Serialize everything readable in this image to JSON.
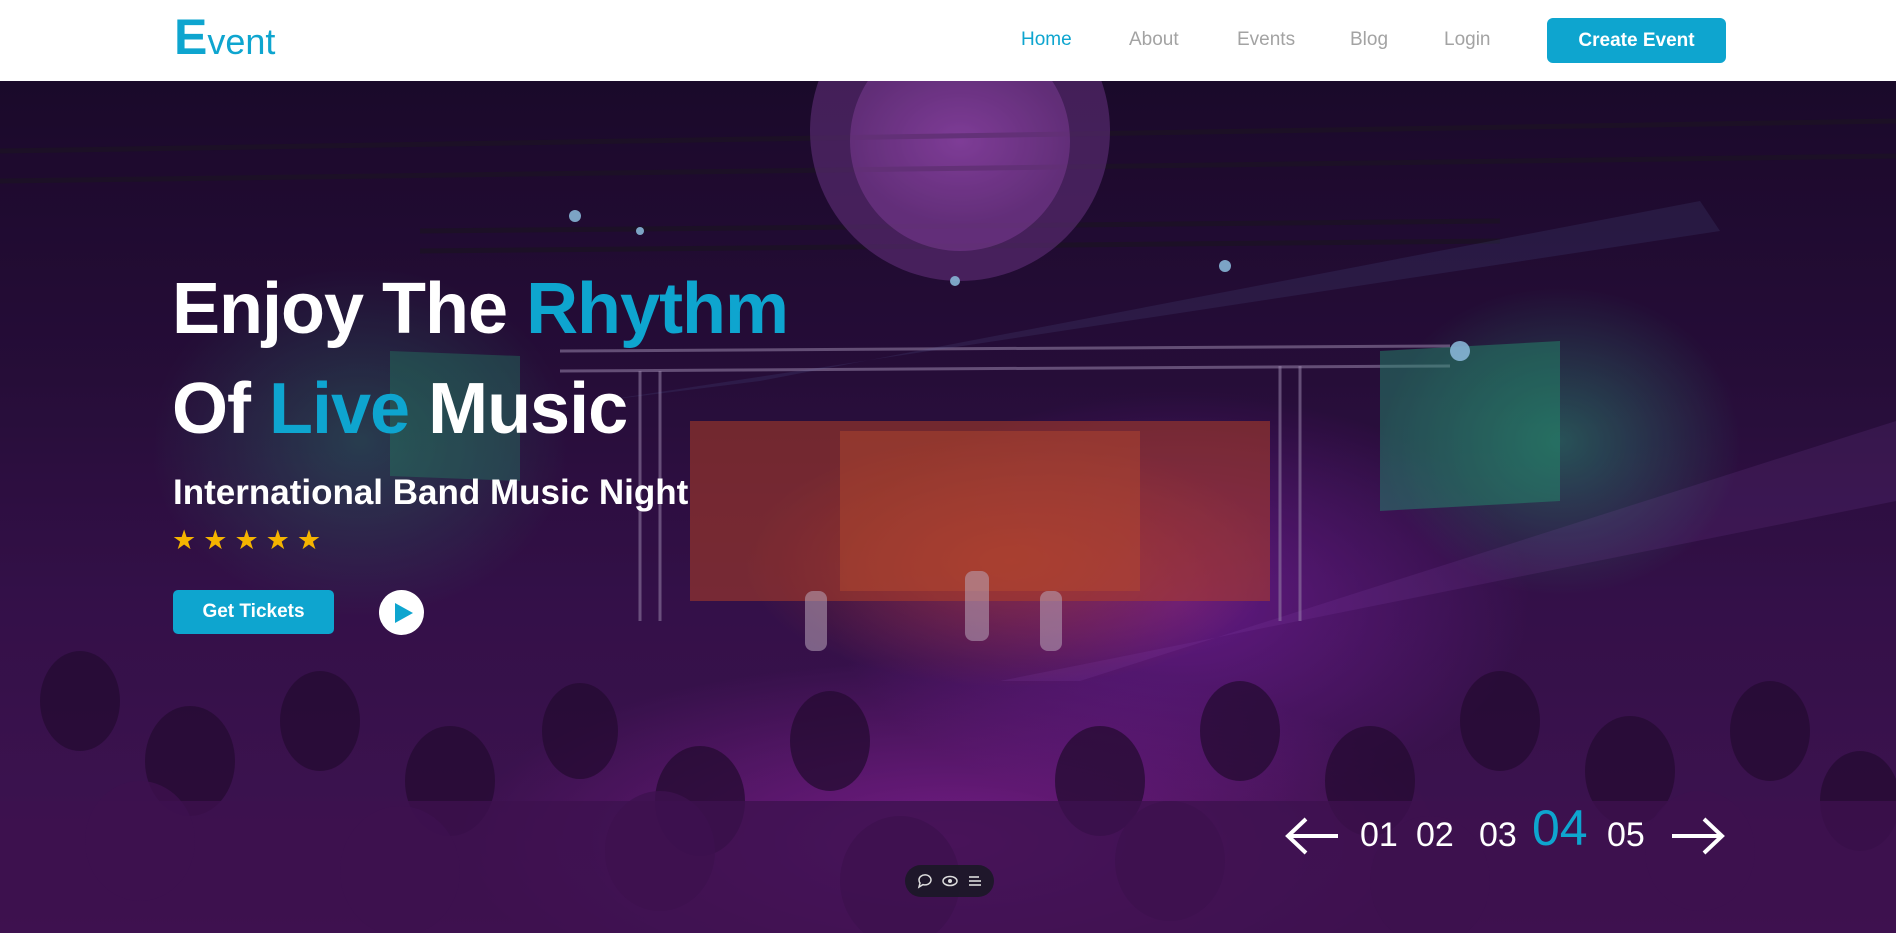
{
  "brand": {
    "logo_big": "E",
    "logo_rest": "vent",
    "accent": "#0ea5cf"
  },
  "nav": {
    "items": [
      {
        "label": "Home",
        "active": true
      },
      {
        "label": "About",
        "active": false
      },
      {
        "label": "Events",
        "active": false
      },
      {
        "label": "Blog",
        "active": false
      },
      {
        "label": "Login",
        "active": false
      }
    ],
    "cta": "Create Event"
  },
  "hero": {
    "line1_a": "Enjoy The",
    "line1_b": "Rhythm",
    "line2_a": "Of",
    "line2_b": "Live",
    "line2_c": "Music",
    "subtitle": "International Band Music Night",
    "rating": 5,
    "tickets_label": "Get Tickets",
    "background_icon": "concert-crowd-image"
  },
  "slider": {
    "pages": [
      "01",
      "02",
      "03",
      "04",
      "05"
    ],
    "current": "04"
  },
  "toolbar": {
    "icons": [
      "comment-icon",
      "eye-icon",
      "list-icon"
    ]
  }
}
